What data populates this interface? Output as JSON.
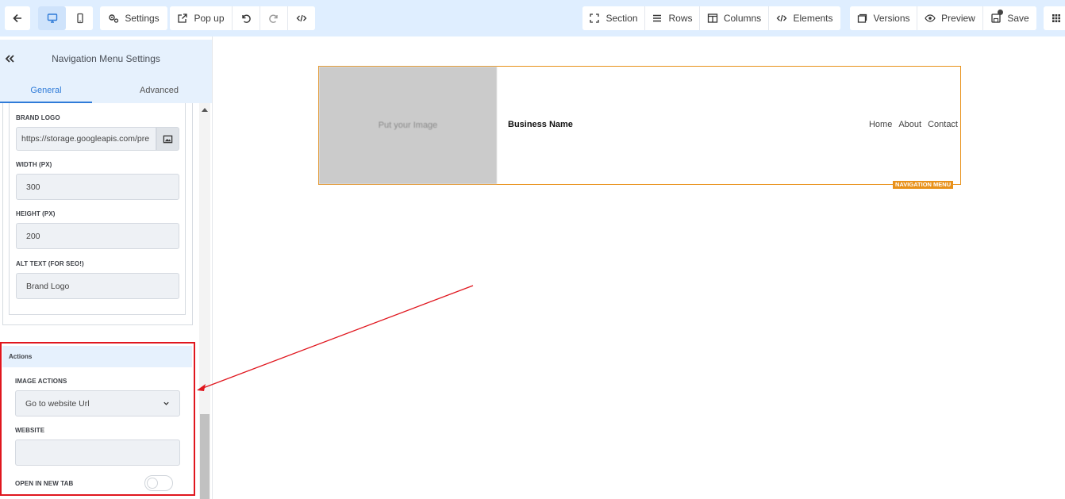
{
  "toolbar": {
    "settings_label": "Settings",
    "popup_label": "Pop up",
    "section_label": "Section",
    "rows_label": "Rows",
    "columns_label": "Columns",
    "elements_label": "Elements",
    "versions_label": "Versions",
    "preview_label": "Preview",
    "save_label": "Save"
  },
  "sidebar": {
    "title": "Navigation Menu Settings",
    "tabs": [
      {
        "label": "General",
        "active": true
      },
      {
        "label": "Advanced",
        "active": false
      }
    ],
    "fields": {
      "brand_logo_label": "BRAND LOGO",
      "brand_logo_value": "https://storage.googleapis.com/pre",
      "width_label": "WIDTH (PX)",
      "width_value": "300",
      "height_label": "HEIGHT (PX)",
      "height_value": "200",
      "alt_label": "ALT TEXT (FOR SEO!)",
      "alt_value": "Brand Logo"
    },
    "actions": {
      "header": "Actions",
      "image_actions_label": "IMAGE ACTIONS",
      "image_actions_value": "Go to website Url",
      "website_label": "WEBSITE",
      "website_value": "",
      "open_new_tab_label": "OPEN IN NEW TAB",
      "open_new_tab_on": false
    }
  },
  "canvas": {
    "image_placeholder": "Put your Image",
    "business_name": "Business Name",
    "nav_links": [
      "Home",
      "About",
      "Contact"
    ],
    "element_tag": "NAVIGATION MENU"
  },
  "colors": {
    "accent": "#2f7bd8",
    "highlight": "#e0161e",
    "element_outline": "#e8911a",
    "toolbar_bg": "#dfeeff"
  }
}
